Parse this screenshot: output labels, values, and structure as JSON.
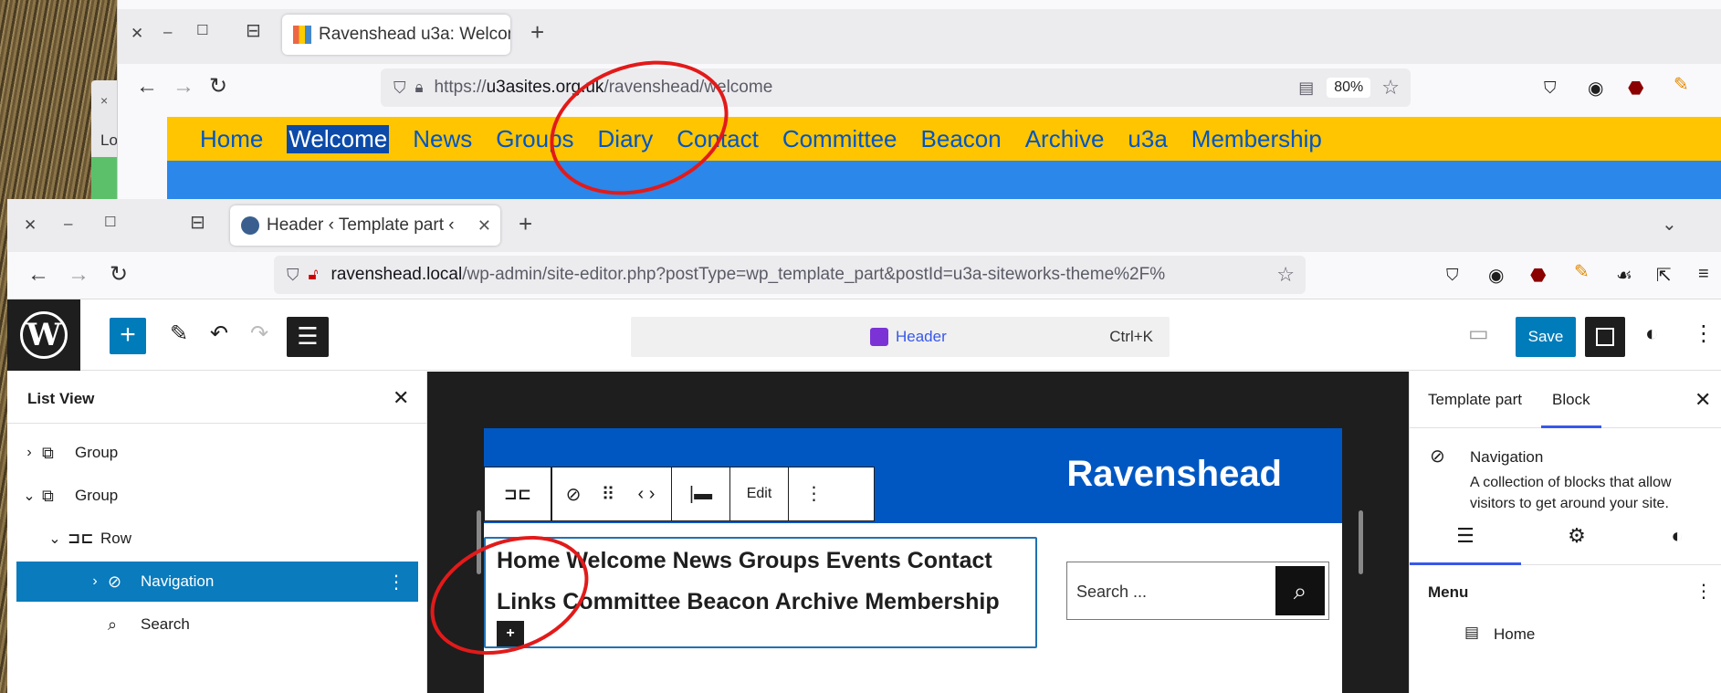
{
  "window1": {
    "tab_title": "Ravenshead u3a: Welcom",
    "url_prefix": "https://",
    "url_host": "u3asites.org.uk",
    "url_path": "/ravenshead/welcome",
    "zoom": "80%",
    "partial_label": "Lo",
    "site_nav": [
      "Home",
      "Welcome",
      "News",
      "Groups",
      "Diary",
      "Contact",
      "Committee",
      "Beacon",
      "Archive",
      "u3a",
      "Membership"
    ]
  },
  "window2": {
    "tab_title": "Header ‹ Template part ‹",
    "url_host": "ravenshead.local",
    "url_path": "/wp-admin/site-editor.php?postType=wp_template_part&postId=u3a-siteworks-theme%2F%"
  },
  "editor": {
    "command_label": "Header",
    "command_shortcut": "Ctrl+K",
    "save_label": "Save",
    "list_view": {
      "title": "List View",
      "items": [
        {
          "label": "Group",
          "icon": "group-icon"
        },
        {
          "label": "Group",
          "icon": "group-icon"
        },
        {
          "label": "Row",
          "icon": "row-icon"
        },
        {
          "label": "Navigation",
          "icon": "compass-icon"
        },
        {
          "label": "Search",
          "icon": "search-icon"
        }
      ]
    },
    "canvas": {
      "site_title": "Ravenshead",
      "toolbar_edit": "Edit",
      "nav_line1": "Home Welcome News Groups Events Contact",
      "nav_line2": "Links Committee Beacon Archive Membership",
      "search_placeholder": "Search ..."
    },
    "sidebar": {
      "tab_template": "Template part",
      "tab_block": "Block",
      "block_name": "Navigation",
      "block_desc": "A collection of blocks that allow visitors to get around your site.",
      "menu_label": "Menu",
      "menu_item": "Home"
    }
  },
  "colors": {
    "site_yellow": "#ffc500",
    "site_blue": "#0057c2",
    "wp_blue": "#007cba",
    "annotation_red": "#e21a1a"
  }
}
